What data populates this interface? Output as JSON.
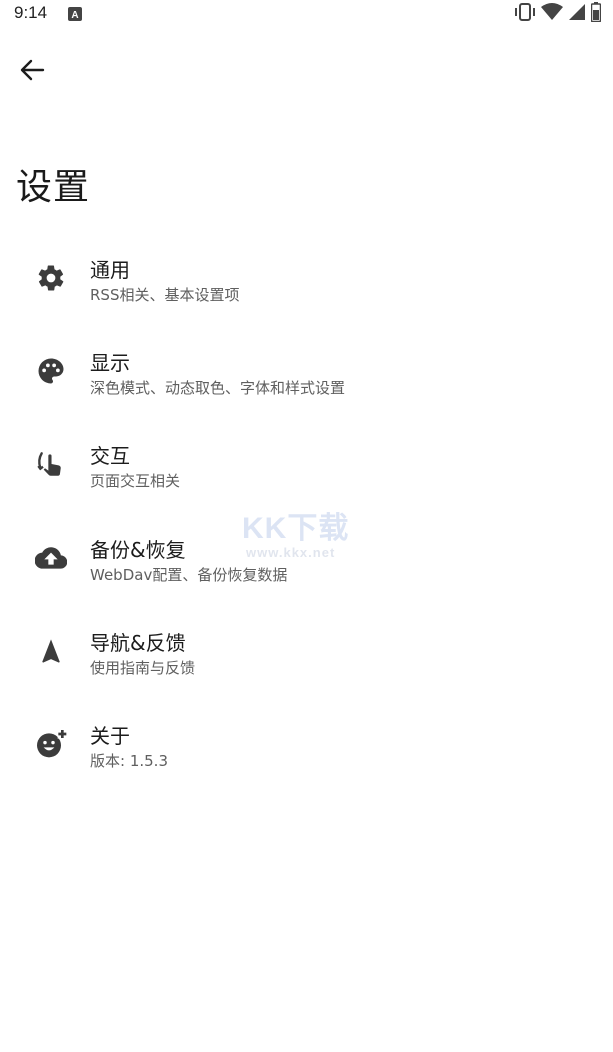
{
  "status_bar": {
    "time": "9:14",
    "icons": [
      "notification-a-icon",
      "vibrate-icon",
      "wifi-icon",
      "signal-icon",
      "battery-icon"
    ]
  },
  "header": {
    "back_icon": "arrow-left-icon",
    "title": "设置"
  },
  "settings": {
    "items": [
      {
        "icon": "gear-icon",
        "title": "通用",
        "subtitle": "RSS相关、基本设置项"
      },
      {
        "icon": "palette-icon",
        "title": "显示",
        "subtitle": "深色模式、动态取色、字体和样式设置"
      },
      {
        "icon": "touch-icon",
        "title": "交互",
        "subtitle": "页面交互相关"
      },
      {
        "icon": "cloud-upload-icon",
        "title": "备份&恢复",
        "subtitle": "WebDav配置、备份恢复数据"
      },
      {
        "icon": "navigation-icon",
        "title": "导航&反馈",
        "subtitle": "使用指南与反馈"
      },
      {
        "icon": "emoji-add-icon",
        "title": "关于",
        "subtitle": "版本: 1.5.3"
      }
    ]
  },
  "watermark": {
    "text": "KK下载",
    "url": "www.kkx.net"
  },
  "colors": {
    "icon": "#3c3c3c",
    "title": "#1c1c1c",
    "subtitle": "#5f5f5f",
    "background": "#ffffff"
  }
}
